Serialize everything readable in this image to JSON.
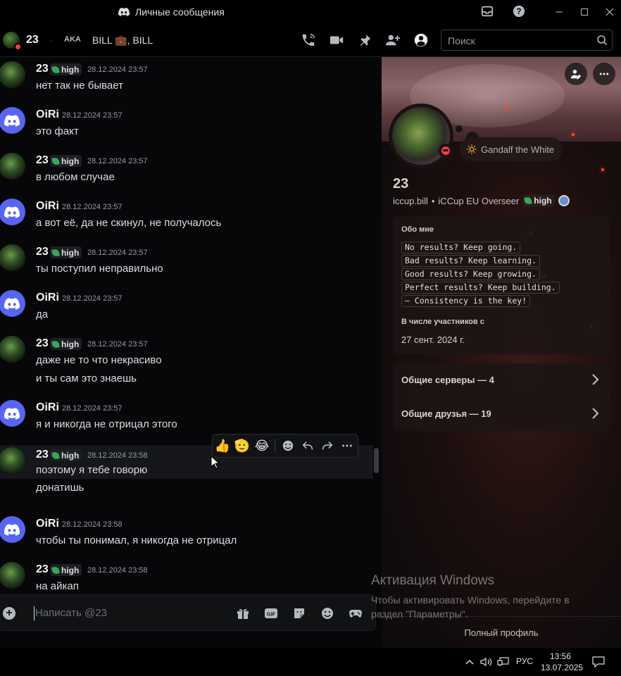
{
  "window": {
    "title": "Личные сообщения"
  },
  "header": {
    "username": "23",
    "aka_label": "AKA",
    "aka_names": "BILL 💼, BILL",
    "search_placeholder": "Поиск"
  },
  "messages": [
    {
      "author": "23",
      "tag": "high",
      "time": "28.12.2024 23:57",
      "lines": [
        "нет так не бывает"
      ]
    },
    {
      "author": "OiRi",
      "tag": "",
      "time": "28.12.2024 23:57",
      "lines": [
        "это факт"
      ]
    },
    {
      "author": "23",
      "tag": "high",
      "time": "28.12.2024 23:57",
      "lines": [
        "в любом случае"
      ]
    },
    {
      "author": "OiRi",
      "tag": "",
      "time": "28.12.2024 23:57",
      "lines": [
        "а вот её, да не скинул, не получалось"
      ]
    },
    {
      "author": "23",
      "tag": "high",
      "time": "28.12.2024 23:57",
      "lines": [
        "ты поступил неправильно"
      ]
    },
    {
      "author": "OiRi",
      "tag": "",
      "time": "28.12.2024 23:57",
      "lines": [
        "да"
      ]
    },
    {
      "author": "23",
      "tag": "high",
      "time": "28.12.2024 23:57",
      "lines": [
        "даже не то что некрасиво",
        "и ты сам это знаешь"
      ]
    },
    {
      "author": "OiRi",
      "tag": "",
      "time": "28.12.2024 23:57",
      "lines": [
        "я и никогда не отрицал этого"
      ]
    },
    {
      "author": "23",
      "tag": "high",
      "time": "28.12.2024 23:58",
      "lines": [
        "поэтому я тебе говорю",
        "донатишь"
      ]
    },
    {
      "author": "OiRi",
      "tag": "",
      "time": "28.12.2024 23:58",
      "lines": [
        "чтобы ты понимал, я никогда не отрицал"
      ]
    },
    {
      "author": "23",
      "tag": "high",
      "time": "28.12.2024 23:58",
      "lines": [
        "на айкап"
      ]
    }
  ],
  "reaction_toolbar": {
    "emojis": [
      "👍",
      "🫡",
      "😂"
    ]
  },
  "composer": {
    "placeholder": "Написать @23"
  },
  "profile": {
    "status_text": "Gandalf the White",
    "display_name": "23",
    "username": "iccup.bill",
    "pronouns": "iCCup EU Overseer",
    "tag": "high",
    "about_title": "Обо мне",
    "about_lines": [
      "No results? Keep going.",
      "Bad results? Keep learning.",
      "Good results? Keep growing.",
      "Perfect results? Keep building.",
      "— Consistency is the key!"
    ],
    "member_since_title": "В числе участников с",
    "member_since": "27 сент. 2024 г.",
    "mutual_servers": "Общие серверы — 4",
    "mutual_friends": "Общие друзья — 19",
    "full_profile": "Полный профиль"
  },
  "watermark": {
    "title": "Активация Windows",
    "line1": "Чтобы активировать Windows, перейдите в",
    "line2": "раздел \"Параметры\"."
  },
  "taskbar": {
    "lang": "РУС",
    "time": "13:56",
    "date": "13.07.2025"
  },
  "colors": {
    "blurple": "#5865f2",
    "dnd": "#f23f43",
    "leaf": "#3ba55c"
  }
}
